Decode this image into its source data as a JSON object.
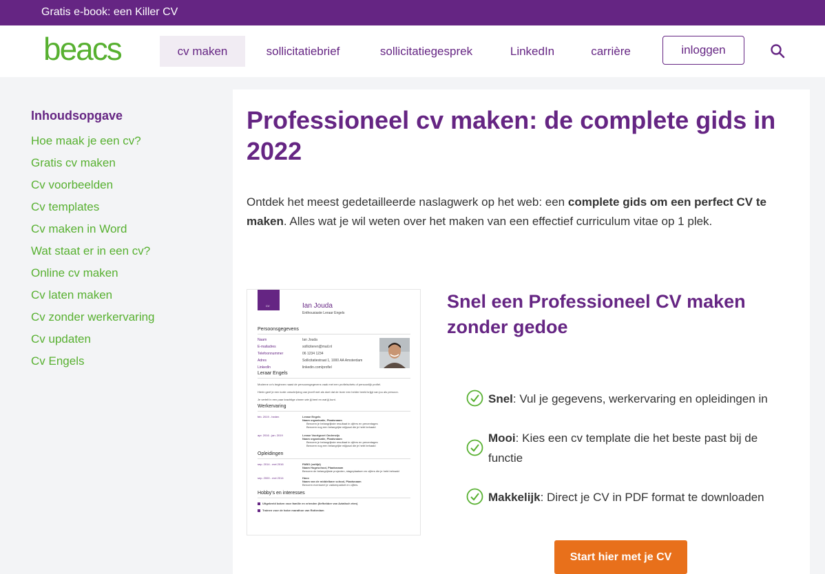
{
  "topbar": {
    "link": "Gratis e-book: een Killer CV"
  },
  "brand": {
    "logo_text": "beacs",
    "logo_color": "#57b030",
    "accent": "#652583",
    "cta_color": "#e8701b"
  },
  "nav": {
    "items": [
      "cv maken",
      "sollicitatiebrief",
      "sollicitatiegesprek",
      "LinkedIn",
      "carrière"
    ],
    "login": "inloggen"
  },
  "sidebar": {
    "title": "Inhoudsopgave",
    "items": [
      "Hoe maak je een cv?",
      "Gratis cv maken",
      "Cv voorbeelden",
      "Cv templates",
      "Cv maken in Word",
      "Wat staat er in een cv?",
      "Online cv maken",
      "Cv laten maken",
      "Cv zonder werkervaring",
      "Cv updaten",
      "Cv Engels"
    ]
  },
  "main": {
    "title": "Professioneel cv maken: de complete gids in 2022",
    "intro_pre": "Ontdek het meest gedetailleerde naslagwerk op het web: een ",
    "intro_bold": "complete gids om een perfect CV te maken",
    "intro_post": ". Alles wat je wil weten over het maken van een effectief curriculum vitae op 1 plek.",
    "subtitle": "Snel een Professioneel CV maken zonder gedoe",
    "benefits": [
      {
        "bold": "Snel",
        "text": ": Vul je gegevens, werkervaring en opleidingen in"
      },
      {
        "bold": "Mooi",
        "text": ": Kies een cv template die het beste past bij de functie"
      },
      {
        "bold": "Makkelijk",
        "text": ": Direct je CV in PDF format te downloaden"
      }
    ],
    "cta": "Start hier met je CV"
  },
  "cv_preview": {
    "badge": "CV",
    "name": "Ian Jouda",
    "role": "Enthousiaste Leraar Engels",
    "sections": {
      "personal": "Persoonsgegevens",
      "profile": "Leraar Engels",
      "work": "Werkervaring",
      "education": "Opleidingen",
      "hobbies": "Hobby's en interesses"
    },
    "personal_rows": [
      [
        "Naam",
        "Ian Jouda"
      ],
      [
        "E-mailadres",
        "solliciteren@mail.nl"
      ],
      [
        "Telefoonnummer",
        "06 1234 1234"
      ],
      [
        "Adres",
        "Sollicitatiestraat 1, 1000 AA Amsterdam"
      ],
      [
        "LinkedIn",
        "linkedin.com/profiel"
      ]
    ],
    "profile_lines": [
      "Moderne cv's beginnen naast de persoonsgegevens vaak met een profielschets of persoonlijk profiel.",
      "Hierin geef je een korte omschrijving van jezelf met als doel dat de lezer een helder beeld krijgt van jou als persoon.",
      "Je vertelt in een paar krachtige zinnen wie jij bent en wat jij kunt."
    ],
    "work": [
      {
        "period": "feb. 2019 - heden",
        "title": "Leraar Engels",
        "org": "Naam organisatie, Plaatsnaam",
        "bullets": [
          "Benoem je belangrijkste resultaat in cijfers en percentages",
          "Benoem nog een belangrijke mijlpaal die je hebt behaald"
        ]
      },
      {
        "period": "apr. 2016 - jan. 2019",
        "title": "Leraar Voortgezet Onderwijs",
        "org": "Naam organisatie, Plaatsnaam",
        "bullets": [
          "Benoem je belangrijkste resultaat in cijfers en percentages",
          "Benoem nog een belangrijke mijlpaal die je hebt behaald"
        ]
      }
    ],
    "education": [
      {
        "period": "sep. 2014 - mei 2016",
        "title": "PABO (voltijd)",
        "org": "Naam Hogeschool, Plaatsnaam",
        "note": "Benoem de belangrijkste projecten, stageplaatsen en cijfers die je hebt behaald"
      },
      {
        "period": "sep. 2000 - mei 2014",
        "title": "Havo",
        "org": "Naam van de middelbare school, Plaatsnaam",
        "note": "Benoem eventueel je vakkenpakket en cijfers."
      }
    ],
    "hobbies": [
      "Uitgebreid koken voor familie en vrienden (liefhebber van Aziatisch eten)",
      "Trainen voor de halve marathon van Rotterdam"
    ]
  }
}
